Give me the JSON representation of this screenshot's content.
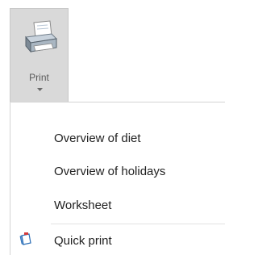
{
  "ribbon": {
    "print_button": {
      "label": "Print",
      "icon": "printer-icon",
      "dropdown_icon": "chevron-down-icon"
    }
  },
  "menu": {
    "items": [
      {
        "label": "Overview of diet"
      },
      {
        "label": "Overview of holidays"
      },
      {
        "label": "Worksheet"
      }
    ],
    "quick_print": {
      "label": "Quick print",
      "icon": "quick-print-icon"
    }
  }
}
